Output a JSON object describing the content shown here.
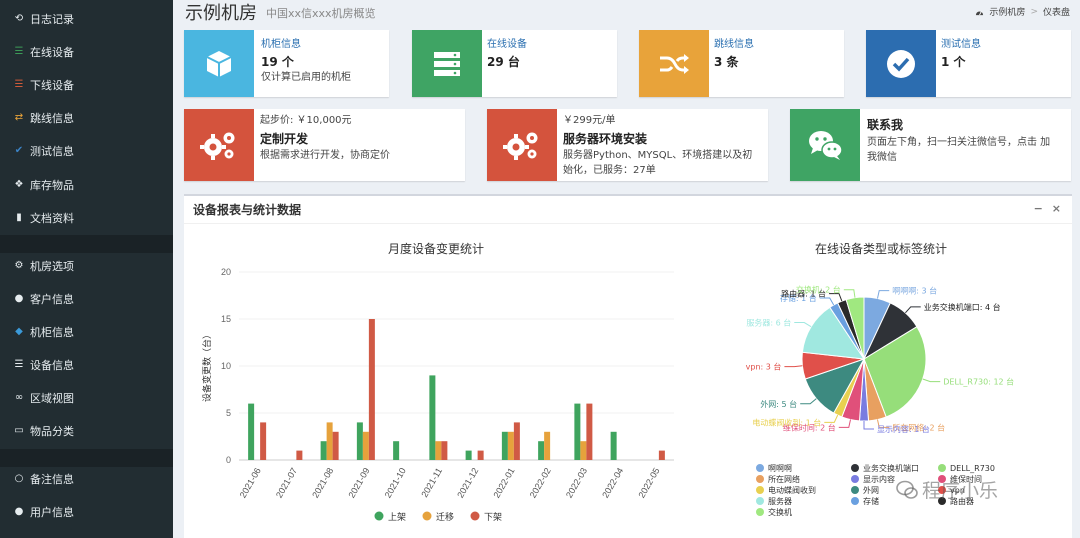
{
  "sidebar": {
    "items": [
      {
        "label": "日志记录",
        "icon": "history-icon",
        "color": "#e6ecef"
      },
      {
        "label": "在线设备",
        "icon": "server-green-icon",
        "color": "#3c9a57"
      },
      {
        "label": "下线设备",
        "icon": "server-red-icon",
        "color": "#d05a3a"
      },
      {
        "label": "跳线信息",
        "icon": "random-icon",
        "color": "#e8a33a"
      },
      {
        "label": "测试信息",
        "icon": "check-circle-icon",
        "color": "#3b82c4"
      },
      {
        "label": "库存物品",
        "icon": "cubes-icon",
        "color": "#e6ecef"
      },
      {
        "label": "文档资料",
        "icon": "book-icon",
        "color": "#e6ecef"
      },
      {
        "label": "机房选项",
        "icon": "cogs-icon",
        "color": "#e6ecef"
      },
      {
        "label": "客户信息",
        "icon": "users-icon",
        "color": "#e6ecef"
      },
      {
        "label": "机柜信息",
        "icon": "cube-icon",
        "color": "#3b9ad9"
      },
      {
        "label": "设备信息",
        "icon": "server-icon",
        "color": "#e6ecef"
      },
      {
        "label": "区域视图",
        "icon": "binoculars-icon",
        "color": "#e6ecef"
      },
      {
        "label": "物品分类",
        "icon": "folder-icon",
        "color": "#e6ecef"
      },
      {
        "label": "备注信息",
        "icon": "circle-icon",
        "color": "#e6ecef"
      },
      {
        "label": "用户信息",
        "icon": "user-icon",
        "color": "#e6ecef"
      }
    ]
  },
  "header": {
    "title": "示例机房",
    "subtitle": "中国xx信xxx机房概览",
    "breadcrumb": [
      "示例机房",
      "仪表盘"
    ]
  },
  "stats": [
    {
      "label": "机柜信息",
      "value": "19 个",
      "desc": "仅计算已启用的机柜",
      "icon": "cube-icon",
      "color": "#4ab6e0"
    },
    {
      "label": "在线设备",
      "value": "29 台",
      "desc": "",
      "icon": "server-icon",
      "color": "#3fa464"
    },
    {
      "label": "跳线信息",
      "value": "3 条",
      "desc": "",
      "icon": "random-icon",
      "color": "#e8a33a"
    },
    {
      "label": "测试信息",
      "value": "1 个",
      "desc": "",
      "icon": "check-circle-icon",
      "color": "#2c6db0"
    }
  ],
  "promos": [
    {
      "top": "起步价: ￥10,000元",
      "title": "定制开发",
      "desc": "根据需求进行开发，协商定价",
      "icon": "cogs-icon",
      "color": "#d4533d"
    },
    {
      "top": "￥299元/单",
      "title": "服务器环境安装",
      "desc1": "服务器Python、MYSQL、环境搭建以及初",
      "desc2": "始化，已服务：27单",
      "icon": "cogs-icon",
      "color": "#d4533d"
    },
    {
      "top": "",
      "title": "联系我",
      "desc1": "页面左下角，扫一扫关注微信号，点击 加",
      "desc2": "我微信",
      "icon": "wechat-icon",
      "color": "#3fa464"
    }
  ],
  "panel": {
    "title": "设备报表与统计数据",
    "minimize": "−",
    "close": "×"
  },
  "chart_data": [
    {
      "type": "bar",
      "title": "月度设备变更统计",
      "ylabel": "设备变更数（台）",
      "ylim": [
        0,
        20
      ],
      "yticks": [
        0,
        5,
        10,
        15,
        20
      ],
      "categories": [
        "2021-06",
        "2021-07",
        "2021-08",
        "2021-09",
        "2021-10",
        "2021-11",
        "2021-12",
        "2022-01",
        "2022-02",
        "2022-03",
        "2022-04",
        "2022-05"
      ],
      "series": [
        {
          "name": "上架",
          "color": "#3fa45e",
          "values": [
            6,
            0,
            2,
            4,
            2,
            9,
            1,
            3,
            2,
            6,
            3,
            0
          ]
        },
        {
          "name": "迁移",
          "color": "#e6a23c",
          "values": [
            0,
            0,
            4,
            3,
            0,
            2,
            0,
            3,
            3,
            2,
            0,
            0
          ]
        },
        {
          "name": "下架",
          "color": "#d05a45",
          "values": [
            4,
            1,
            3,
            15,
            0,
            2,
            1,
            4,
            0,
            6,
            0,
            1
          ]
        }
      ]
    },
    {
      "type": "pie",
      "title": "在线设备类型或标签统计",
      "slices": [
        {
          "name": "啊啊啊",
          "value": 3,
          "color": "#7ca9e0",
          "label": "啊啊啊: 3 台"
        },
        {
          "name": "业务交换机端口",
          "value": 4,
          "color": "#2f3237",
          "label": "业务交换机端口: 4 台"
        },
        {
          "name": "DELL_R730",
          "value": 12,
          "color": "#96de7a",
          "label": "DELL_R730: 12 台"
        },
        {
          "name": "所在网络",
          "value": 2,
          "color": "#e8a060",
          "label": "所在网络: 2 台"
        },
        {
          "name": "显示内容",
          "value": 1,
          "color": "#7a7ce0",
          "label": "显示内容: 1 台"
        },
        {
          "name": "维保时间",
          "value": 2,
          "color": "#e0507a",
          "label": "维保时间: 2 台"
        },
        {
          "name": "电动蝶阀收到",
          "value": 1,
          "color": "#e8d050",
          "label": "电动蝶阀收到: 1 台"
        },
        {
          "name": "外网",
          "value": 5,
          "color": "#3d8a80",
          "label": "外网: 5 台"
        },
        {
          "name": "vpn",
          "value": 3,
          "color": "#e0504a",
          "label": "vpn: 3 台"
        },
        {
          "name": "服务器",
          "value": 6,
          "color": "#a0e8e0",
          "label": "服务器: 6 台"
        },
        {
          "name": "存储",
          "value": 1,
          "color": "#6aa0e0",
          "label": "存储: 1 台"
        },
        {
          "name": "路由器",
          "value": 1,
          "color": "#2a2a2a",
          "label": "路由器: 1 台"
        },
        {
          "name": "交换机",
          "value": 2,
          "color": "#a0e880",
          "label": "交换机: 2 台"
        }
      ],
      "legend": [
        [
          "啊啊啊",
          "业务交换机端口",
          "DELL_R730"
        ],
        [
          "所在网络",
          "显示内容",
          "维保时间"
        ],
        [
          "电动蝶阀收到",
          "外网",
          "vpn"
        ],
        [
          "服务器",
          "存储",
          "路由器"
        ],
        [
          "交换机"
        ]
      ]
    }
  ],
  "watermark": "程序小乐"
}
